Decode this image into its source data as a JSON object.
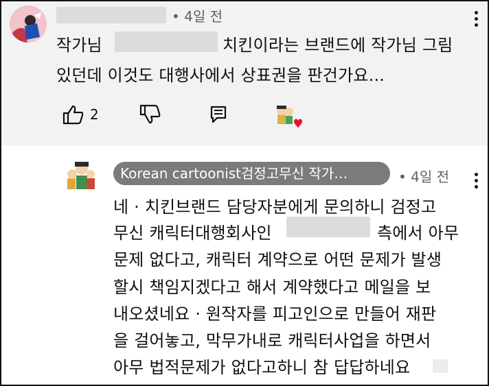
{
  "comment": {
    "time": "• 4일 전",
    "lines": [
      {
        "before": "작가님",
        "after": "치킨이라는 브랜드에 작가님 그림"
      },
      {
        "text": "있던데 이것도 대행사에서 상표권을 판건가요..."
      }
    ],
    "like_count": "2",
    "icons": {
      "like": "thumbs-up-icon",
      "dislike": "thumbs-down-icon",
      "reply": "reply-icon",
      "creator_heart": "creator-heart-icon",
      "menu": "more-vert-icon"
    }
  },
  "reply": {
    "author": "Korean cartoonist검정고무신 작가…",
    "time": "• 4일 전",
    "lines": [
      {
        "text": "네 · 치킨브랜드 담당자분에게 문의하니 검정고"
      },
      {
        "before": "무신 캐릭터대행회사인",
        "after": "측에서 아무"
      },
      {
        "text": "문제 없다고, 캐릭터 계약으로 어떤 문제가 발생"
      },
      {
        "text": "할시 책임지겠다고  해서 계약했다고 메일을 보"
      },
      {
        "text": "내오셨네요 · 원작자를 피고인으로 만들어 재판"
      },
      {
        "text": "을 걸어놓고, 막무가내로 캐릭터사업을 하면서"
      },
      {
        "text": "아무 법적문제가 없다고하니 참 답답하네요"
      }
    ],
    "icons": {
      "menu": "more-vert-icon"
    }
  },
  "colors": {
    "top_background": "#f2f2f2",
    "chip_background": "#7b7b7b",
    "heart": "#e0142b",
    "meta_text": "#606060"
  }
}
